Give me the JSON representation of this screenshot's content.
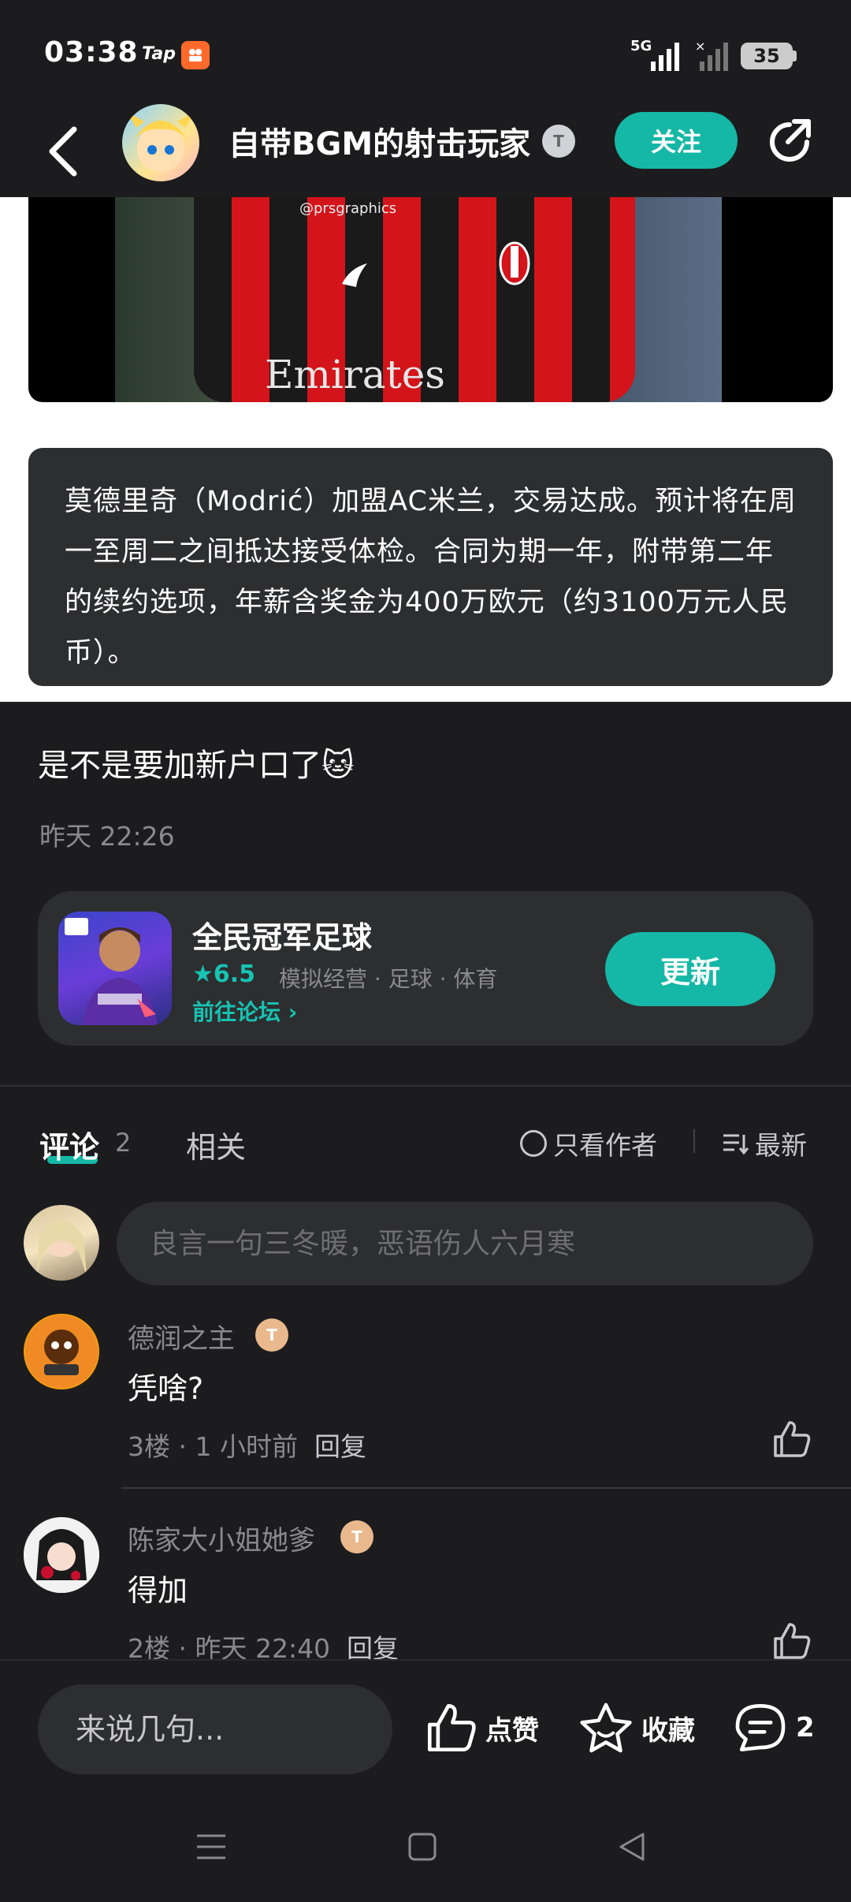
{
  "status_bar": {
    "time": "03:38",
    "tap_label": "Tap",
    "network": "5G",
    "battery": "35"
  },
  "header": {
    "author": "自带BGM的射击玩家",
    "author_badge": "T",
    "follow_label": "关注"
  },
  "article": {
    "watermark": "@prsgraphics",
    "shirt_text": "Emirates",
    "quote": "莫德里奇（Modrić）加盟AC米兰，交易达成。预计将在周一至周二之间抵达接受体检。合同为期一年，附带第二年的续约选项，年薪含奖金为400万欧元（约3100万元人民币）。"
  },
  "post": {
    "text": "是不是要加新户口了",
    "emoji": "🐱",
    "time": "昨天 22:26"
  },
  "game_card": {
    "title": "全民冠军足球",
    "rating": "6.5",
    "tags": "模拟经营 · 足球 · 体育",
    "forum_link": "前往论坛",
    "update_label": "更新"
  },
  "tabs": {
    "comments_label": "评论",
    "comments_count": "2",
    "related_label": "相关",
    "only_author_label": "只看作者",
    "sort_label": "最新"
  },
  "comment_input": {
    "placeholder": "良言一句三冬暖，恶语伤人六月寒"
  },
  "comments": [
    {
      "name": "德润之主",
      "badge": "T",
      "text": "凭啥?",
      "floor_time": "3楼 · 1 小时前",
      "reply": "回复"
    },
    {
      "name": "陈家大小姐她爹",
      "badge": "T",
      "text": "得加",
      "floor_time": "2楼 · 昨天 22:40",
      "reply": "回复"
    }
  ],
  "bottom_bar": {
    "say_placeholder": "来说几句...",
    "like_label": "点赞",
    "collect_label": "收藏",
    "comment_count": "2"
  },
  "colors": {
    "accent": "#15b8a6",
    "background": "#1c1c1e",
    "card": "#2d2e30"
  }
}
